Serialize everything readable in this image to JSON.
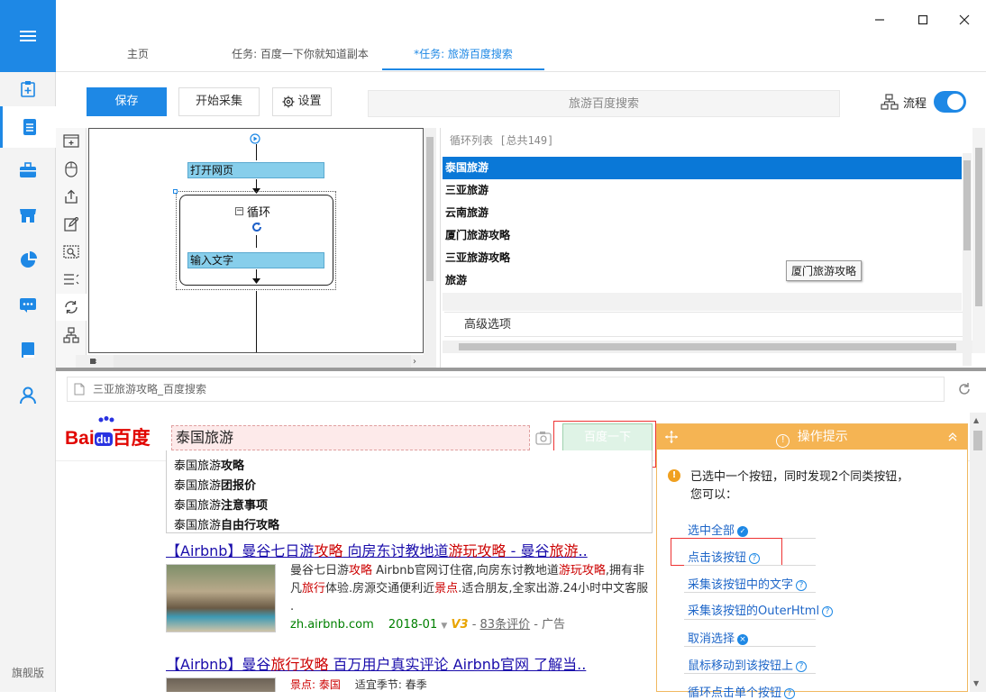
{
  "sidebar": {
    "edition_label": "旗舰版",
    "items": [
      "new-task",
      "task-list",
      "toolbox",
      "store",
      "data",
      "message",
      "tutorial",
      "account"
    ]
  },
  "tabs": [
    {
      "label": "主页"
    },
    {
      "label": "任务: 百度一下你就知道副本"
    },
    {
      "label": "*任务: 旅游百度搜索"
    }
  ],
  "toolbar": {
    "save_label": "保存",
    "start_label": "开始采集",
    "settings_label": "设置",
    "task_name": "旅游百度搜索",
    "flow_label": "流程"
  },
  "flow": {
    "open_page": "打开网页",
    "loop": "循环",
    "input_text": "输入文字"
  },
  "loop_list": {
    "header": "循环列表 [总共149]",
    "items": [
      "泰国旅游",
      "三亚旅游",
      "云南旅游",
      "厦门旅游攻略",
      "三亚旅游攻略",
      "旅游"
    ],
    "tooltip": "厦门旅游攻略",
    "advanced_label": "高级选项"
  },
  "browser": {
    "url_title": "三亚旅游攻略_百度搜索",
    "search_value": "泰国旅游",
    "search_button": "百度一下",
    "suggestions": [
      {
        "prefix": "泰国旅游",
        "suffix": "攻略"
      },
      {
        "prefix": "泰国旅游",
        "suffix": "团报价"
      },
      {
        "prefix": "泰国旅游",
        "suffix": "注意事项"
      },
      {
        "prefix": "泰国旅游",
        "suffix": "自由行攻略"
      }
    ],
    "result1": {
      "title_a": "【Airbnb】曼谷七日游",
      "title_b": "攻略",
      "title_c": " 向房东讨教地道",
      "title_d": "游玩攻略",
      "title_e": " - 曼谷",
      "title_f": "旅游",
      "title_g": "..",
      "line1_a": "曼谷七日游",
      "line1_b": "攻略",
      "line1_c": " Airbnb官网订住宿,向房东讨教地道",
      "line1_d": "游玩攻略",
      "line1_e": ",拥有非",
      "line2_a": "凡",
      "line2_b": "旅行",
      "line2_c": "体验.房源交通便利近",
      "line2_d": "景点",
      "line2_e": ".适合朋友,全家出游.24小时中文客服",
      "line3": ".",
      "site": "zh.airbnb.com",
      "date": "2018-01",
      "v3": "V3",
      "reviews": "83条评价",
      "ad": "- 广告"
    },
    "result2": {
      "title_a": "【Airbnb】曼谷",
      "title_b": "旅行攻略",
      "title_c": " 百万用户真实评论 Airbnb官网 了解当..",
      "line1_a": "景点: 泰国",
      "line1_b": "适宜季节: 春季"
    }
  },
  "hint_panel": {
    "title": "操作提示",
    "message_line1": "已选中一个按钮，同时发现2个同类按钮，",
    "message_line2": "您可以：",
    "select_all": "选中全部",
    "click_button": "点击该按钮",
    "collect_text": "采集该按钮中的文字",
    "collect_outer": "采集该按钮的OuterHtml",
    "cancel_select": "取消选择",
    "mouse_move": "鼠标移动到该按钮上",
    "loop_click": "循环点击单个按钮"
  },
  "colors": {
    "accent": "#1e88e5",
    "selected_row": "#0a78d7",
    "hint_header": "#f5b453",
    "highlight": "#e33333"
  }
}
